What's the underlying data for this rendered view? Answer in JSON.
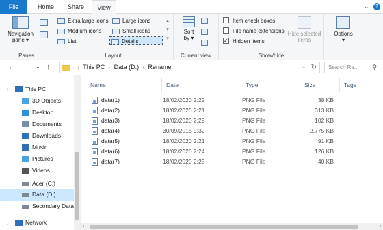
{
  "tabs": {
    "file": "File",
    "home": "Home",
    "share": "Share",
    "view": "View"
  },
  "titlebar": {
    "collapse_glyph": "⌄",
    "help_glyph": "?"
  },
  "ribbon": {
    "panes": {
      "nav_label_1": "Navigation",
      "nav_label_2": "pane ▾",
      "title": "Panes"
    },
    "layout": {
      "title": "Layout",
      "items": [
        "Extra large icons",
        "Large icons",
        "Medium icons",
        "Small icons",
        "List",
        "Details"
      ],
      "selected": "Details"
    },
    "current_view": {
      "sort_label_1": "Sort",
      "sort_label_2": "by ▾",
      "title": "Current view"
    },
    "show_hide": {
      "title": "Show/hide",
      "checkboxes": [
        {
          "label": "Item check boxes",
          "checked": false
        },
        {
          "label": "File name extensions",
          "checked": false
        },
        {
          "label": "Hidden items",
          "checked": true
        }
      ],
      "hide_selected_1": "Hide selected",
      "hide_selected_2": "items"
    },
    "options": {
      "label": "Options",
      "arrow": "▾"
    }
  },
  "address": {
    "back": "←",
    "forward": "→",
    "dropdown": "⌄",
    "up": "↑",
    "crumbs": [
      "This PC",
      "Data (D:)",
      "Rename"
    ],
    "refresh": "↻",
    "search_placeholder": "Search Re..."
  },
  "nav": {
    "items": [
      {
        "label": "This PC",
        "icon": "pc-icon"
      },
      {
        "label": "3D Objects",
        "icon": "cube-icon"
      },
      {
        "label": "Desktop",
        "icon": "desktop-icon"
      },
      {
        "label": "Documents",
        "icon": "documents-icon"
      },
      {
        "label": "Downloads",
        "icon": "downloads-icon"
      },
      {
        "label": "Music",
        "icon": "music-icon"
      },
      {
        "label": "Pictures",
        "icon": "pictures-icon"
      },
      {
        "label": "Videos",
        "icon": "videos-icon"
      },
      {
        "label": "Acer (C:)",
        "icon": "drive-icon"
      },
      {
        "label": "Data  (D:)",
        "icon": "drive-icon"
      },
      {
        "label": "Secondary Data",
        "icon": "drive-icon"
      },
      {
        "label": "Network",
        "icon": "network-icon"
      }
    ],
    "selected": "Data  (D:)"
  },
  "columns": {
    "name": "Name",
    "date": "Date",
    "type": "Type",
    "size": "Size",
    "tags": "Tags"
  },
  "files": [
    {
      "name": "data(1)",
      "date": "18/02/2020 2:22",
      "type": "PNG File",
      "size": "38 KB"
    },
    {
      "name": "data(2)",
      "date": "18/02/2020 2:21",
      "type": "PNG File",
      "size": "313 KB"
    },
    {
      "name": "data(3)",
      "date": "18/02/2020 2:29",
      "type": "PNG File",
      "size": "102 KB"
    },
    {
      "name": "data(4)",
      "date": "30/09/2015 9:32",
      "type": "PNG File",
      "size": "2.775 KB"
    },
    {
      "name": "data(5)",
      "date": "18/02/2020 2:21",
      "type": "PNG File",
      "size": "91 KB"
    },
    {
      "name": "data(6)",
      "date": "18/02/2020 2:24",
      "type": "PNG File",
      "size": "126 KB"
    },
    {
      "name": "data(7)",
      "date": "18/02/2020 2:23",
      "type": "PNG File",
      "size": "40 KB"
    }
  ],
  "colors": {
    "accent": "#1979ca",
    "selection": "#cce8ff",
    "header_text": "#4c607a"
  }
}
